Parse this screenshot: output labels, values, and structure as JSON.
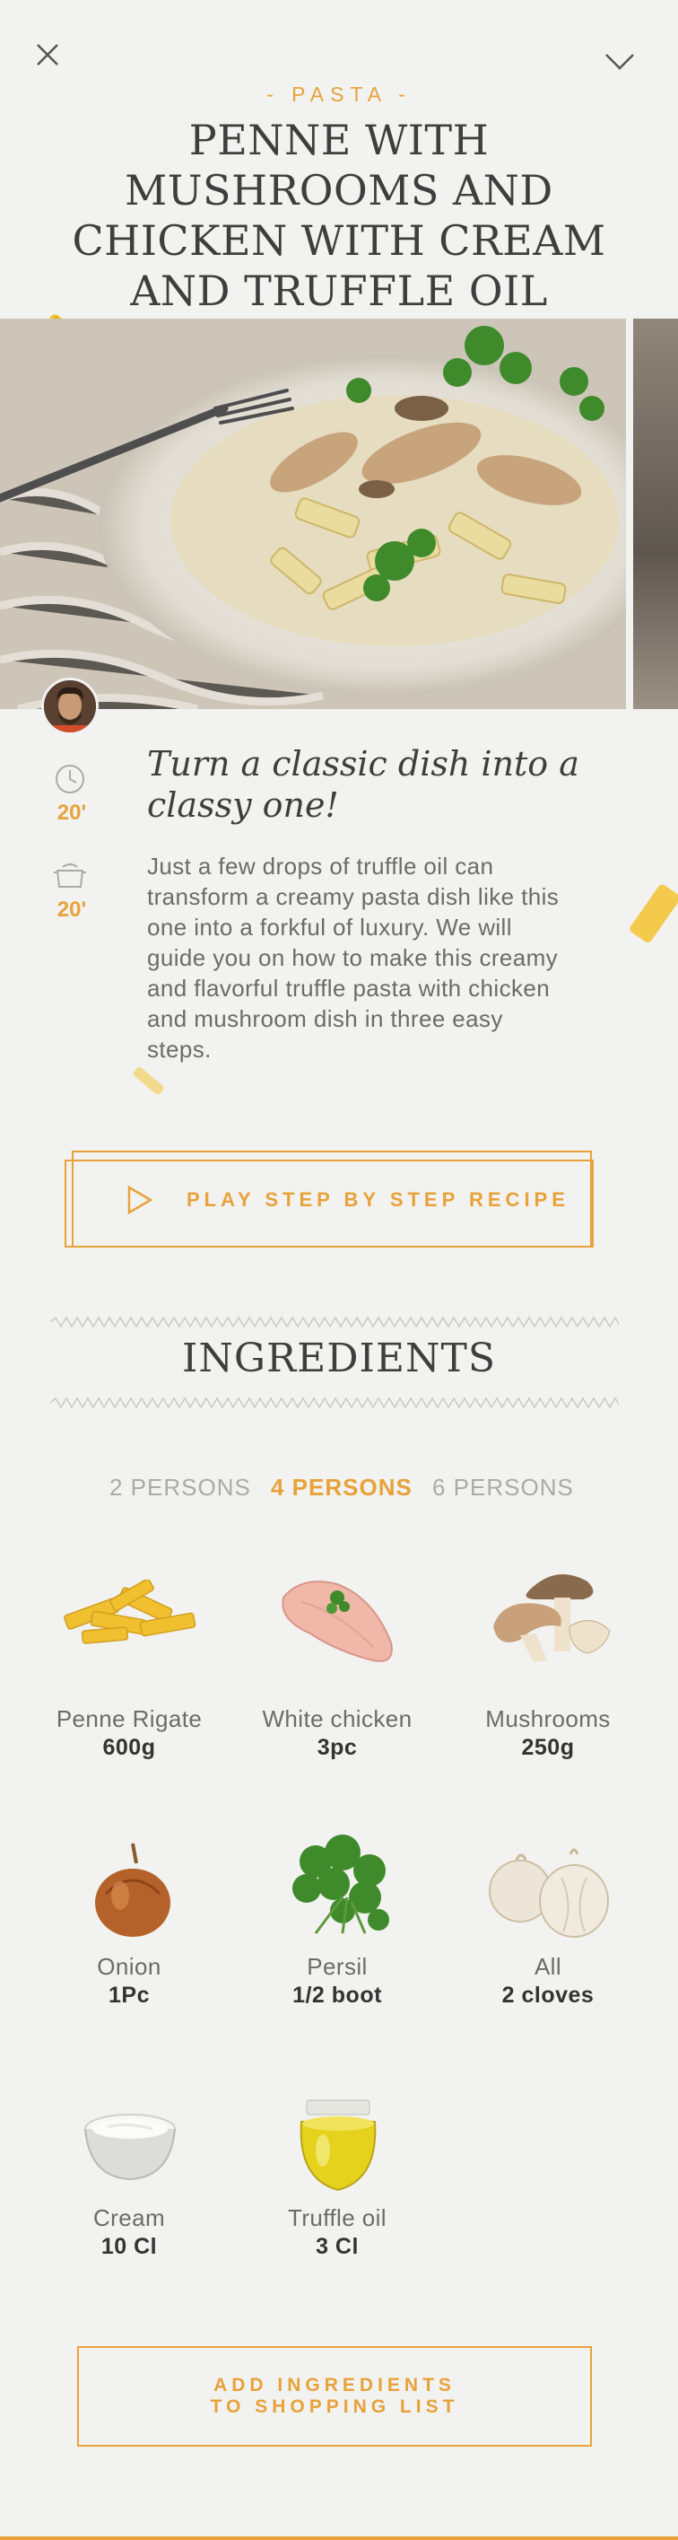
{
  "header": {
    "category": "- PASTA -",
    "title": "PENNE WITH MUSHROOMS AND CHICKEN WITH CREAM AND TRUFFLE OIL",
    "close_icon": "close-icon",
    "collapse_icon": "chevron-down-icon"
  },
  "recipe": {
    "prep_time": "20'",
    "cook_time": "20'",
    "tagline": "Turn a classic dish into a classy one!",
    "description": "Just a few drops of truffle oil can transform a creamy pasta dish like this one into a forkful of luxury. We will guide you on how to make this creamy and flavorful truffle pasta with chicken and mushroom dish in three easy steps.",
    "play_label": "PLAY STEP BY STEP RECIPE"
  },
  "ingredients": {
    "title": "INGREDIENTS",
    "persons": [
      "2 PERSONS",
      "4 PERSONS",
      "6 PERSONS"
    ],
    "selected_persons": "4 PERSONS",
    "items": [
      {
        "name": "Penne Rigate",
        "qty": "600g"
      },
      {
        "name": "White chicken",
        "qty": "3pc"
      },
      {
        "name": "Mushrooms",
        "qty": "250g"
      },
      {
        "name": "Onion",
        "qty": "1Pc"
      },
      {
        "name": "Persil",
        "qty": "1/2 boot"
      },
      {
        "name": "All",
        "qty": "2 cloves"
      },
      {
        "name": "Cream",
        "qty": "10 Cl"
      },
      {
        "name": "Truffle oil",
        "qty": "3 Cl"
      }
    ],
    "add_button": "ADD INGREDIENTS TO SHOPPING LIST"
  },
  "colors": {
    "accent": "#e8a23a",
    "background": "#f2f2f0",
    "title": "#3e3e3e"
  }
}
